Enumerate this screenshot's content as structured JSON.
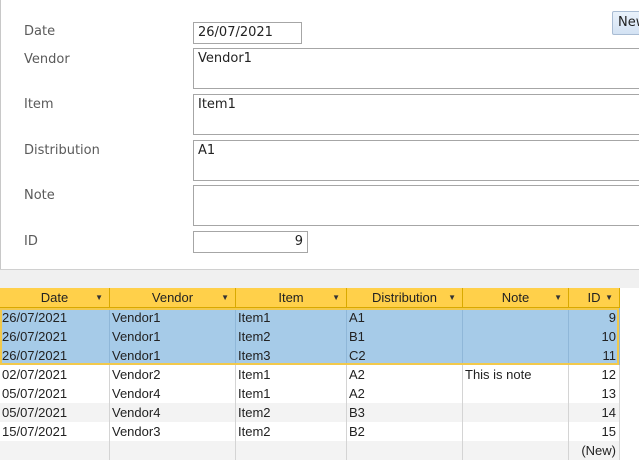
{
  "form": {
    "date_label": "Date",
    "date_value": "26/07/2021",
    "vendor_label": "Vendor",
    "vendor_value": "Vendor1",
    "item_label": "Item",
    "item_value": "Item1",
    "distribution_label": "Distribution",
    "distribution_value": "A1",
    "note_label": "Note",
    "note_value": "",
    "id_label": "ID",
    "id_value": "9",
    "new_button": "New"
  },
  "grid": {
    "columns": [
      "Date",
      "Vendor",
      "Item",
      "Distribution",
      "Note",
      "ID"
    ],
    "rows": [
      {
        "date": "26/07/2021",
        "vendor": "Vendor1",
        "item": "Item1",
        "distribution": "A1",
        "note": "",
        "id": "9",
        "selected": true
      },
      {
        "date": "26/07/2021",
        "vendor": "Vendor1",
        "item": "Item2",
        "distribution": "B1",
        "note": "",
        "id": "10",
        "selected": true
      },
      {
        "date": "26/07/2021",
        "vendor": "Vendor1",
        "item": "Item3",
        "distribution": "C2",
        "note": "",
        "id": "11",
        "selected": true
      },
      {
        "date": "02/07/2021",
        "vendor": "Vendor2",
        "item": "Item1",
        "distribution": "A2",
        "note": "This is note",
        "id": "12",
        "selected": false
      },
      {
        "date": "05/07/2021",
        "vendor": "Vendor4",
        "item": "Item1",
        "distribution": "A2",
        "note": "",
        "id": "13",
        "selected": false
      },
      {
        "date": "05/07/2021",
        "vendor": "Vendor4",
        "item": "Item2",
        "distribution": "B3",
        "note": "",
        "id": "14",
        "selected": false
      },
      {
        "date": "15/07/2021",
        "vendor": "Vendor3",
        "item": "Item2",
        "distribution": "B2",
        "note": "",
        "id": "15",
        "selected": false
      }
    ],
    "new_row_label": "(New)"
  },
  "colors": {
    "header": "#ffd04a",
    "selected_row": "#a6cbe8",
    "alt_row": "#f3f3f3"
  }
}
